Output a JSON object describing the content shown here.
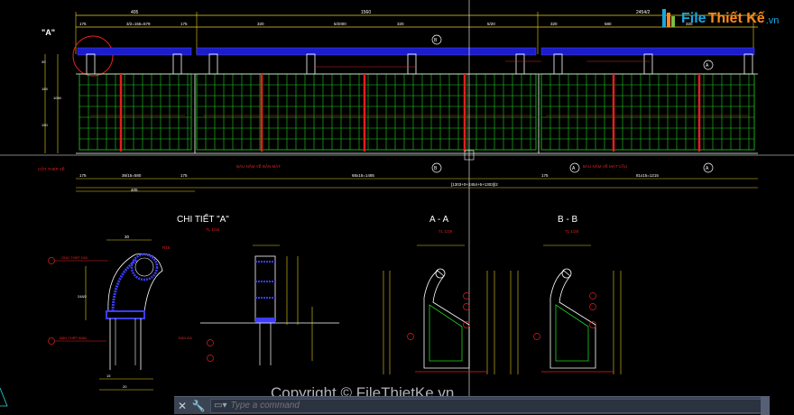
{
  "drawing": {
    "top_dims": [
      "405",
      "1560",
      "2454/2"
    ],
    "top_subdims": [
      "175",
      "3/2=155=579",
      "175",
      "320",
      "5/2000",
      "320",
      "5/20",
      "320",
      "580",
      "320"
    ],
    "detail_marker": "\"A\"",
    "section_markers": [
      "B",
      "A",
      "B",
      "A",
      "A"
    ],
    "bottom_dims": [
      "175",
      "36/15=580",
      "175",
      "68x15=1485",
      "175",
      "81x15=1215"
    ],
    "bottom_total": "405",
    "bottom_formula": "[1303+0+2454+5+1303]/2",
    "left_dims": [
      "30",
      "155",
      "150",
      "1050",
      "1054",
      "30"
    ],
    "section_titles": {
      "detail_a": "CHI TIẾT \"A\"",
      "detail_a_scale": "TL 1/15",
      "section_aa": "A - A",
      "section_aa_scale": "TL 1/25",
      "section_bb": "B - B",
      "section_bb_scale": "TL 1/25"
    },
    "notes": {
      "red_label_1": "BÁU NẮM VỀ BẢN MẶT",
      "red_label_2": "BÁU NẮM VỀ MẶT CẦU",
      "red_label_3": "CỐT THÉP VỀ",
      "red_label_4": "ỐNG THÉP D90",
      "red_label_5": "BẢN THÉP 6MM",
      "red_label_6": "BẢN ĐÁ"
    },
    "detail_dims": [
      "30",
      "R15",
      "248/2",
      "40",
      "15",
      "20"
    ]
  },
  "logo": {
    "part1": "File",
    "part2": "Thiết Kế",
    "part3": ".vn"
  },
  "watermark": "Copyright © FileThietKe.vn",
  "command_line": {
    "placeholder": "Type a command",
    "close_icon": "close-icon",
    "wrench_icon": "wrench-icon"
  },
  "colors": {
    "background": "#000000",
    "grid_green": "#1fd21f",
    "dim_red": "#e02020",
    "rail_blue": "#1c1cc8",
    "text_white": "#ffffff",
    "dim_yellow": "#e8d020",
    "dim_cyan": "#2ad8d8"
  }
}
